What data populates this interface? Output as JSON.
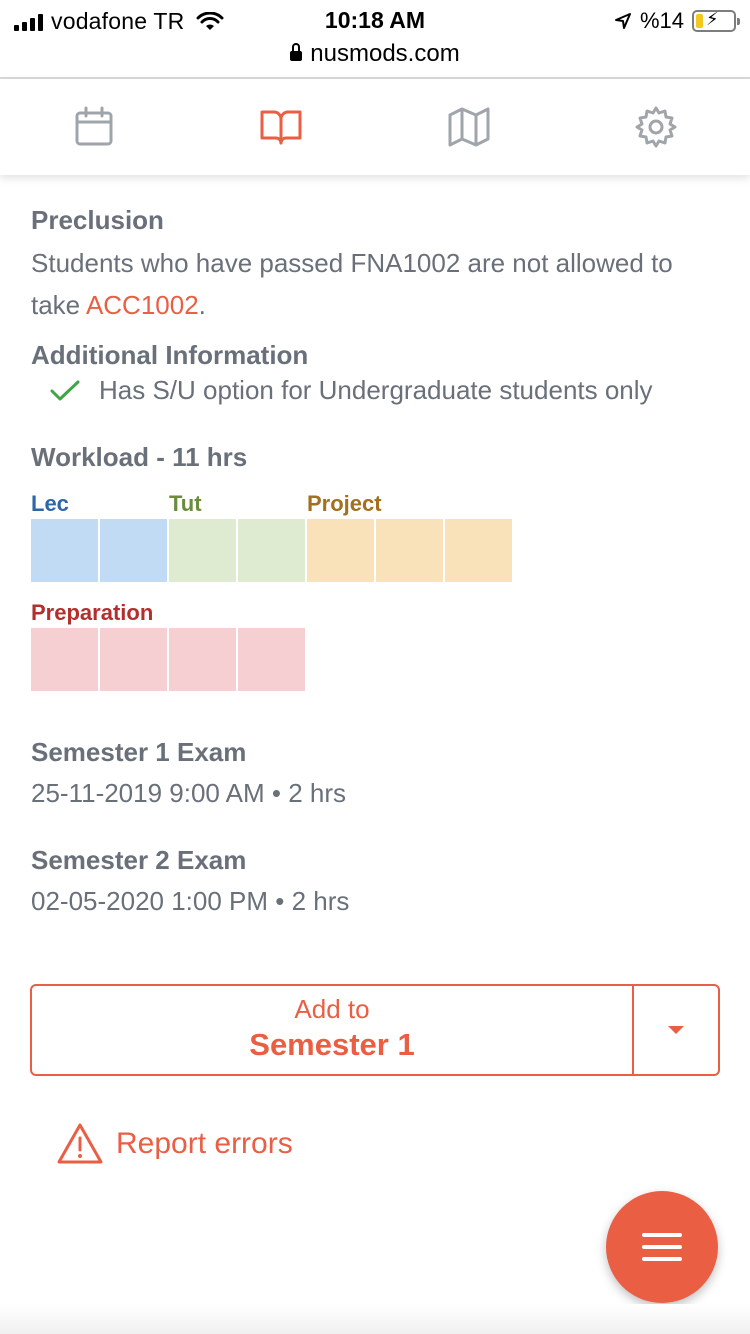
{
  "status_bar": {
    "carrier": "vodafone TR",
    "time": "10:18 AM",
    "battery_text": "%14",
    "url": "nusmods.com"
  },
  "nav": {
    "items": [
      {
        "icon": "calendar-icon",
        "active": false
      },
      {
        "icon": "book-icon",
        "active": true
      },
      {
        "icon": "map-icon",
        "active": false
      },
      {
        "icon": "gear-icon",
        "active": false
      }
    ],
    "active_color": "#ea5f44",
    "inactive_color": "#a0a5ac"
  },
  "preclusion": {
    "heading": "Preclusion",
    "text_before": "Students who have passed FNA1002 are not allowed to take ",
    "link": "ACC1002",
    "text_after": "."
  },
  "additional": {
    "heading": "Additional Information",
    "item": "Has S/U option for Undergraduate students only"
  },
  "workload": {
    "title": "Workload - 11 hrs",
    "categories": [
      {
        "label": "Lec",
        "hours": 2,
        "color": "#2d67a8",
        "fill": "#c2dbf5"
      },
      {
        "label": "Tut",
        "hours": 2,
        "color": "#6b8c3a",
        "fill": "#dfebd1"
      },
      {
        "label": "Project",
        "hours": 3,
        "color": "#a2701e",
        "fill": "#f9e2b9"
      },
      {
        "label": "Preparation",
        "hours": 4,
        "color": "#b52e2e",
        "fill": "#f6cfd3"
      }
    ]
  },
  "exams": [
    {
      "title": "Semester 1 Exam",
      "detail": "25-11-2019 9:00 AM • 2 hrs"
    },
    {
      "title": "Semester 2 Exam",
      "detail": "02-05-2020 1:00 PM • 2 hrs"
    }
  ],
  "add_button": {
    "line1": "Add to",
    "line2": "Semester 1"
  },
  "report": {
    "label": "Report errors"
  },
  "accent": "#ea5f44"
}
